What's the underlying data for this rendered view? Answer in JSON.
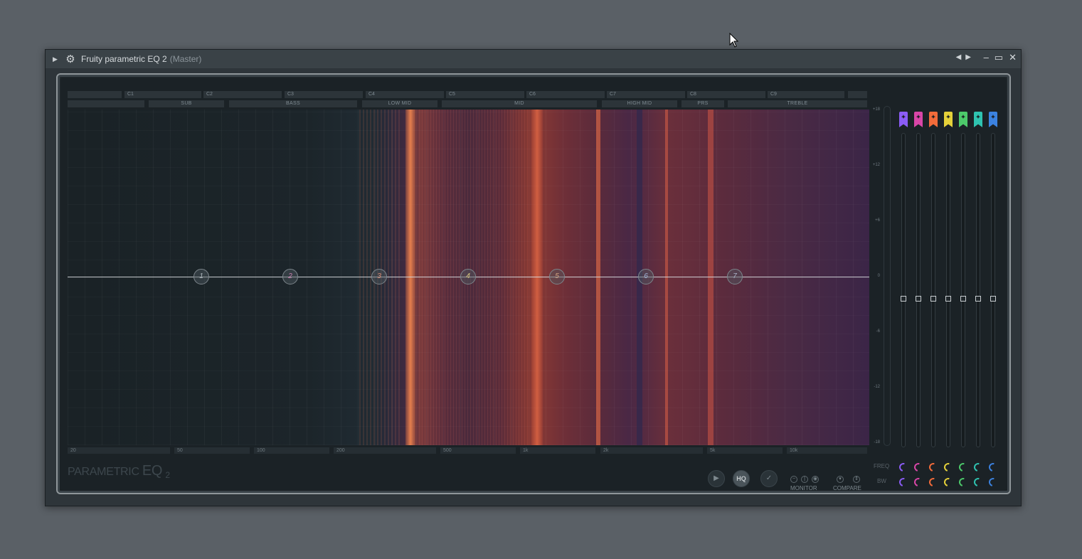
{
  "window": {
    "title": "Fruity parametric EQ 2",
    "subtitle": "(Master)"
  },
  "note_labels": [
    "C1",
    "C2",
    "C3",
    "C4",
    "C5",
    "C6",
    "C7",
    "C8",
    "C9"
  ],
  "bands": [
    "SUB",
    "BASS",
    "LOW MID",
    "MID",
    "HIGH MID",
    "PRS",
    "TREBLE"
  ],
  "freq_labels": [
    "20",
    "50",
    "100",
    "200",
    "500",
    "1k",
    "2k",
    "5k",
    "10k"
  ],
  "db_labels": [
    "+18",
    "+12",
    "+6",
    "0",
    "-6",
    "-12",
    "-18"
  ],
  "eq_nodes": [
    "1",
    "2",
    "3",
    "4",
    "5",
    "6",
    "7"
  ],
  "band_colors": [
    "#8b5cf6",
    "#d946a8",
    "#f26b3a",
    "#e5d13a",
    "#4cc96a",
    "#2fc3b0",
    "#3b82e0"
  ],
  "logo": {
    "main": "PARAMETRIC",
    "eq": "EQ",
    "num": "2"
  },
  "controls": {
    "hq": "HQ",
    "monitor": "MONITOR",
    "compare": "COMPARE",
    "freq": "FREQ",
    "bw": "BW"
  }
}
